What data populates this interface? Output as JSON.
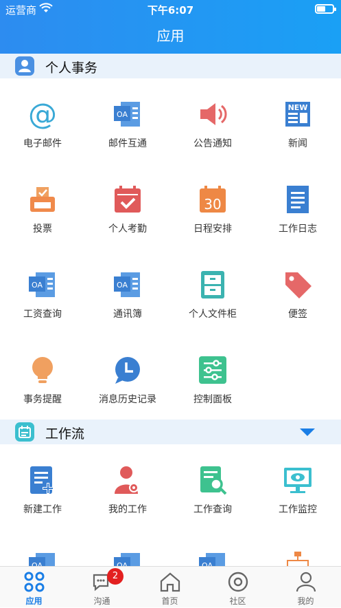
{
  "status_bar": {
    "carrier": "运营商",
    "time": "下午6:07"
  },
  "header": {
    "title": "应用"
  },
  "sections": {
    "personal": {
      "title": "个人事务",
      "items": [
        {
          "label": "电子邮件",
          "icon": "at-sign-icon"
        },
        {
          "label": "邮件互通",
          "icon": "oa-doc-icon"
        },
        {
          "label": "公告通知",
          "icon": "speaker-icon"
        },
        {
          "label": "新闻",
          "icon": "newspaper-icon"
        },
        {
          "label": "投票",
          "icon": "ballot-box-icon"
        },
        {
          "label": "个人考勤",
          "icon": "calendar-check-icon"
        },
        {
          "label": "日程安排",
          "icon": "calendar-30-icon"
        },
        {
          "label": "工作日志",
          "icon": "notebook-icon"
        },
        {
          "label": "工资查询",
          "icon": "oa-doc-icon"
        },
        {
          "label": "通讯簿",
          "icon": "oa-doc-icon"
        },
        {
          "label": "个人文件柜",
          "icon": "cabinet-icon"
        },
        {
          "label": "便签",
          "icon": "tag-icon"
        },
        {
          "label": "事务提醒",
          "icon": "bulb-icon"
        },
        {
          "label": "消息历史记录",
          "icon": "clock-chat-icon"
        },
        {
          "label": "控制面板",
          "icon": "sliders-icon"
        }
      ]
    },
    "workflow": {
      "title": "工作流",
      "items": [
        {
          "label": "新建工作",
          "icon": "new-doc-icon"
        },
        {
          "label": "我的工作",
          "icon": "user-gear-icon"
        },
        {
          "label": "工作查询",
          "icon": "doc-search-icon"
        },
        {
          "label": "工作监控",
          "icon": "monitor-eye-icon"
        }
      ]
    }
  },
  "tabbar": {
    "tabs": [
      {
        "label": "应用",
        "icon": "apps-icon"
      },
      {
        "label": "沟通",
        "icon": "chat-icon",
        "badge": "2"
      },
      {
        "label": "首页",
        "icon": "home-icon"
      },
      {
        "label": "社区",
        "icon": "community-icon"
      },
      {
        "label": "我的",
        "icon": "profile-icon"
      }
    ]
  },
  "colors": {
    "accent": "#1a7ee6",
    "badge": "#e32020"
  }
}
